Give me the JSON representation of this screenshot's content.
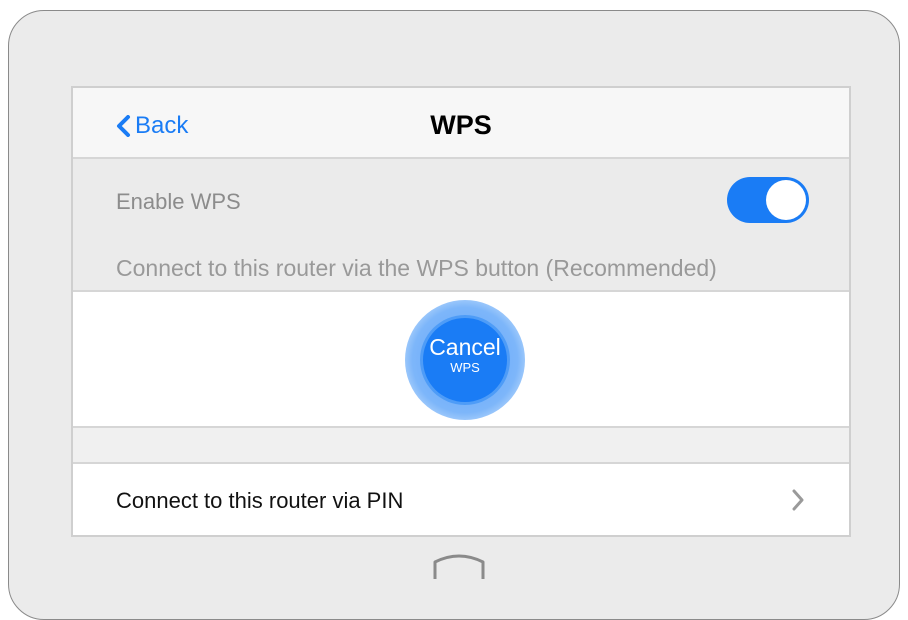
{
  "navbar": {
    "back_label": "Back",
    "title": "WPS"
  },
  "settings": {
    "enable_label": "Enable WPS",
    "enable_state": "on",
    "wps_button_section": "Connect to this router via the WPS button (Recommended)"
  },
  "wps_button": {
    "main_label": "Cancel",
    "sub_label": "WPS"
  },
  "pin_row": {
    "label": "Connect to this router via PIN"
  },
  "icons": {
    "back": "chevron-left-icon",
    "row": "chevron-right-icon",
    "home": "home-button-icon"
  },
  "colors": {
    "accent": "#1a7cf5",
    "device_frame": "#ebebeb",
    "muted_text": "#8c8c8c"
  }
}
